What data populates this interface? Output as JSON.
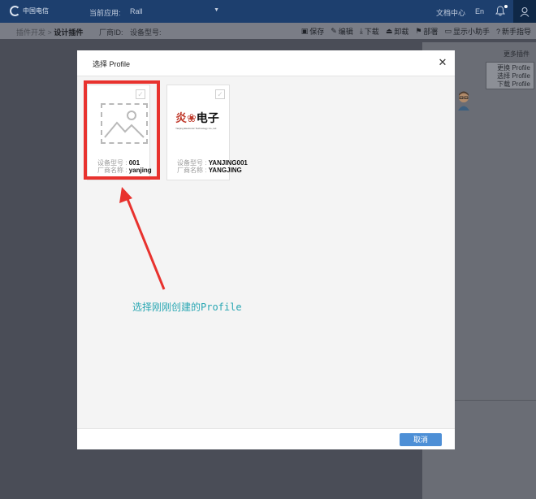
{
  "header": {
    "logo_text": "中国电信",
    "app_label": "当前应用:",
    "app_value": "Rall",
    "docs": "文档中心",
    "lang": "En"
  },
  "toolbar": {
    "crumb_parent": "插件开发",
    "crumb_sep": ">",
    "crumb_current": "设计插件",
    "vendor_id_label": "厂商ID:",
    "model_label": "设备型号:",
    "actions": {
      "save": "保存",
      "edit": "编辑",
      "download": "下载",
      "uninstall": "卸载",
      "deploy": "部署",
      "assistant": "显示小助手",
      "guide": "新手指导"
    }
  },
  "right_panel": {
    "more_plugins": "更多插件",
    "tip_lines": [
      "更换 Profile",
      "选择 Profile",
      "下载 Profile"
    ]
  },
  "dialog": {
    "title": "选择 Profile",
    "cancel": "取消",
    "cards": [
      {
        "model_key": "设备型号 :",
        "model_value": "001",
        "vendor_key": "厂商名称 :",
        "vendor_value": "yanjing"
      },
      {
        "model_key": "设备型号 :",
        "model_value": "YANJING001",
        "vendor_key": "厂商名称 :",
        "vendor_value": "YANGJING",
        "logo_text_a": "炎",
        "logo_text_b": "电子",
        "logo_sub": "Yanjing Electronic Technology Co.,Ltd"
      }
    ]
  },
  "annotation": "选择刚刚创建的Profile",
  "colors": {
    "header_bg": "#1d3f6e",
    "highlight": "#e8322e",
    "annotation": "#2aa7b3",
    "button": "#4d8fd6"
  }
}
